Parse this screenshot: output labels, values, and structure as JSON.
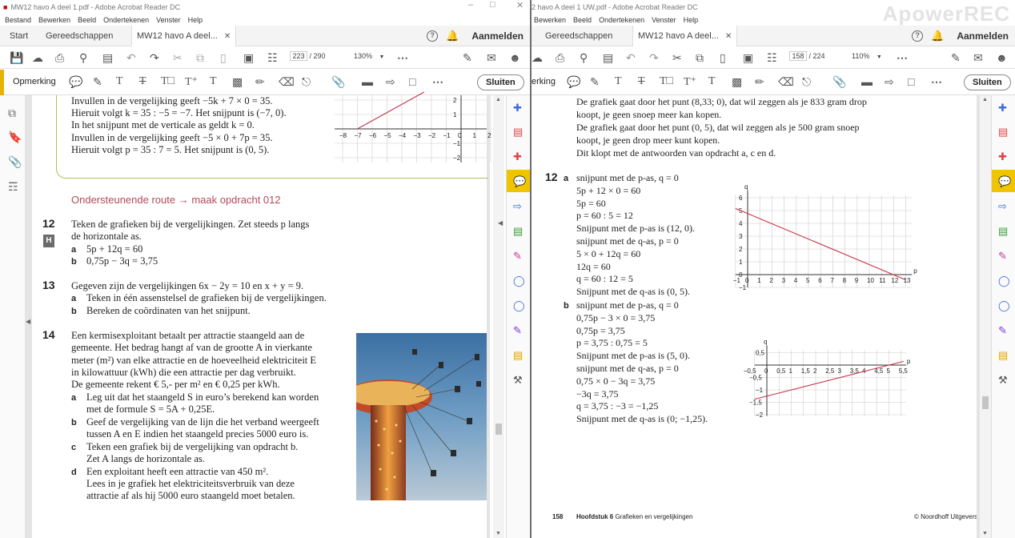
{
  "left": {
    "title": "MW12 havo A deel 1.pdf - Adobe Acrobat Reader DC",
    "menu": [
      "Bestand",
      "Bewerken",
      "Beeld",
      "Ondertekenen",
      "Venster",
      "Help"
    ],
    "tabs": {
      "start": "Start",
      "tools": "Gereedschappen",
      "doc": "MW12 havo A deel..."
    },
    "signin": "Aanmelden",
    "page_current": "223",
    "page_total": "/ 290",
    "zoom": "130%",
    "comment_label": "Opmerking",
    "close_label": "Sluiten",
    "content": {
      "prev_lines": [
        "Invullen in de vergelijking geeft −5k + 7 × 0 = 35.",
        "Hieruit volgt k = 35 : −5 = −7. Het snijpunt is (−7, 0).",
        "In het snijpunt met de verticale as  geldt k = 0.",
        "Invullen in de vergelijking geeft −5 × 0 + 7p = 35.",
        "Hieruit volgt p = 35 : 7 = 5. Het snijpunt is (0, 5)."
      ],
      "graph_y_labels": [
        "2",
        "1",
        "−1",
        "−2"
      ],
      "graph_x_labels": [
        "−8",
        "−7",
        "−6",
        "−5",
        "−4",
        "−3",
        "−2",
        "−1",
        "0",
        "1",
        "2"
      ],
      "route": "Ondersteunende route → maak opdracht 012",
      "q12": {
        "num": "12",
        "badge": "H",
        "text1": "Teken de grafieken bij de vergelijkingen. Zet steeds p langs",
        "text2": "de horizontale as.",
        "a": "5p + 12q = 60",
        "b": "0,75p − 3q = 3,75"
      },
      "q13": {
        "num": "13",
        "text": "Gegeven zijn de vergelijkingen 6x − 2y = 10 en x + y = 9.",
        "a": "Teken in één assenstelsel de grafieken bij de vergelijkingen.",
        "b": "Bereken de coördinaten van het snijpunt."
      },
      "q14": {
        "num": "14",
        "lines": [
          "Een kermisexploitant betaalt per attractie staangeld aan de",
          "gemeente. Het bedrag hangt af van de grootte A in vierkante",
          "meter (m²) van elke attractie en de hoeveelheid elektriciteit E",
          "in kilowattuur (kWh) die een attractie per dag verbruikt.",
          "De gemeente rekent € 5,- per m² en € 0,25 per kWh."
        ],
        "a1": "Leg uit dat het staangeld S in euro’s berekend kan worden",
        "a2": "met de formule S = 5A + 0,25E.",
        "b1": "Geef de vergelijking van de lijn die het verband weergeeft",
        "b2": "tussen A en E indien het staangeld precies 5000 euro is.",
        "c1": "Teken een grafiek bij de vergelijking van opdracht b.",
        "c2": "Zet A langs de horizontale as.",
        "d1": "Een exploitant heeft een attractie van 450 m².",
        "d2": "Lees in je grafiek het elektriciteitsverbruik van deze",
        "d3": "attractie af als hij 5000 euro staangeld moet betalen."
      }
    }
  },
  "right": {
    "title": "2 havo A deel 1 UW.pdf - Adobe Acrobat Reader DC",
    "menu": [
      "Bewerken",
      "Beeld",
      "Ondertekenen",
      "Venster",
      "Help"
    ],
    "tabs": {
      "tools": "Gereedschappen",
      "doc": "MW12 havo A deel..."
    },
    "signin": "Aanmelden",
    "page_current": "158",
    "page_total": "/ 224",
    "zoom": "110%",
    "comment_label": "erking",
    "close_label": "Sluiten",
    "watermark": "ApowerREC",
    "content": {
      "intro": [
        "De grafiek gaat door het punt (8,33; 0), dat wil zeggen als je 833 gram drop",
        "koopt, je geen snoep meer kan kopen.",
        "De grafiek gaat door het punt (0, 5), dat wil zeggen als je 500 gram snoep",
        "koopt, je geen drop meer kunt kopen.",
        "Dit klopt met de antwoorden van opdracht a, c en d."
      ],
      "q12num": "12",
      "a_label": "a",
      "a_lines": [
        "snijpunt met de p-as, q = 0",
        "5p + 12 × 0 = 60",
        "5p = 60",
        "p = 60 : 5 = 12",
        "Snijpunt met de p-as is (12, 0).",
        "snijpunt met de q-as, p = 0",
        "5 × 0 + 12q = 60",
        "12q = 60",
        "q = 60 : 12 = 5",
        "Snijpunt met de q-as is (0, 5)."
      ],
      "b_label": "b",
      "b_lines": [
        "snijpunt met de p-as, q = 0",
        "0,75p − 3 × 0 = 3,75",
        "0,75p = 3,75",
        "p = 3,75 : 0,75 = 5",
        "Snijpunt met de p-as is (5, 0).",
        "snijpunt met de q-as, p = 0",
        "0,75 × 0 − 3q = 3,75",
        "−3q = 3,75",
        "q = 3,75 : −3 = −1,25",
        "Snijpunt met de q-as is (0; −1,25)."
      ],
      "graph1": {
        "ylabel": "q",
        "xlabel": "p",
        "yt": [
          "6",
          "5",
          "4",
          "3",
          "2",
          "1",
          "0",
          "−1"
        ],
        "xt": [
          "−1",
          "0",
          "1",
          "2",
          "3",
          "4",
          "5",
          "6",
          "7",
          "8",
          "9",
          "10",
          "11",
          "12",
          "13"
        ]
      },
      "graph2": {
        "ylabel": "q",
        "xlabel": "p",
        "yt": [
          "0,5",
          "−0,5",
          "−1",
          "−1,5",
          "−2"
        ],
        "xt": [
          "−0,5",
          "0",
          "0,5",
          "1",
          "1,5",
          "2",
          "2,5",
          "3",
          "3,5",
          "4",
          "4,5",
          "5",
          "5,5"
        ]
      },
      "footer": {
        "page": "158",
        "chapter": "Hoofdstuk 6",
        "chapter_title": "Grafieken en vergelijkingen",
        "publisher": "© Noordhoff Uitgevers"
      }
    }
  }
}
